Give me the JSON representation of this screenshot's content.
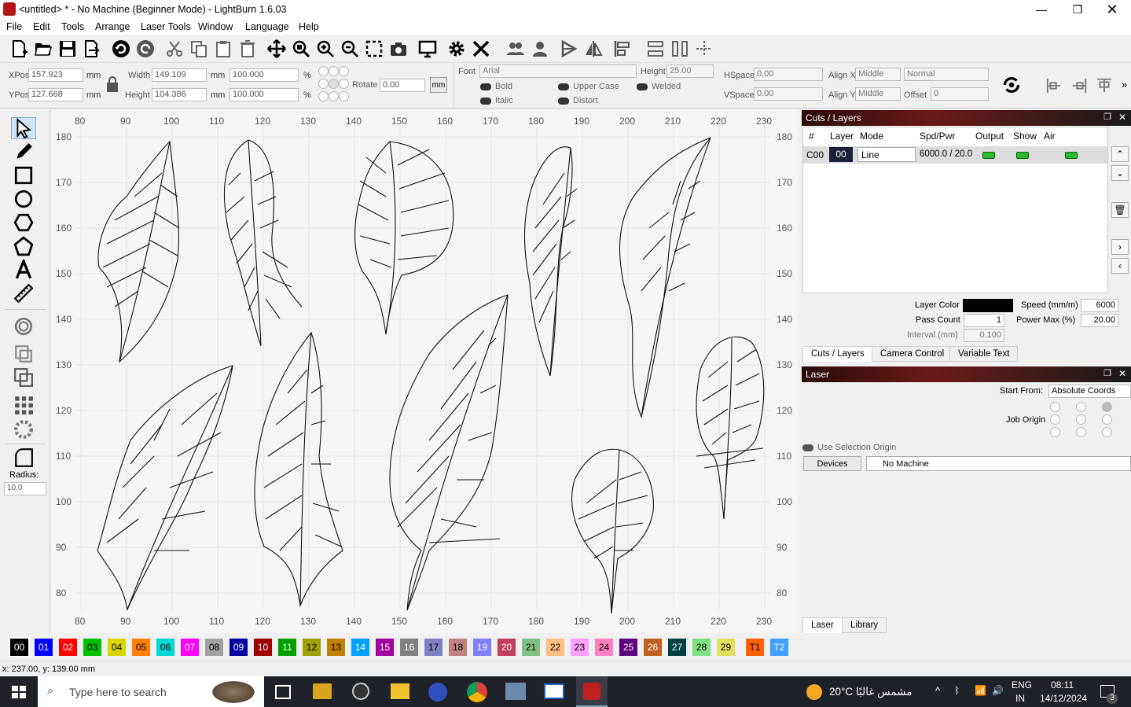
{
  "window": {
    "title": "<untitled> * - No Machine (Beginner Mode) - LightBurn 1.6.03"
  },
  "menu": [
    "File",
    "Edit",
    "Tools",
    "Arrange",
    "Laser Tools",
    "Window",
    "Language",
    "Help"
  ],
  "toolbar_icons": [
    "new-file",
    "open-file",
    "save",
    "export",
    "undo",
    "redo",
    "cut",
    "copy",
    "paste",
    "delete",
    "move",
    "zoom-frame",
    "zoom-in",
    "zoom-out",
    "select-rect",
    "camera",
    "monitor",
    "settings",
    "tools",
    "group",
    "user",
    "send",
    "mirror",
    "align"
  ],
  "props": {
    "xpos_label": "XPos",
    "xpos": "157.923",
    "ypos_label": "YPos",
    "ypos": "127.668",
    "unit_mm": "mm",
    "width_label": "Width",
    "width": "149.109",
    "height_label": "Height",
    "height": "104.386",
    "wpct": "100.000",
    "hpct": "100.000",
    "pct": "%",
    "rotate_label": "Rotate",
    "rotate": "0.00",
    "mm_btn": "mm",
    "font_label": "Font",
    "font": "Arial",
    "fheight_label": "Height",
    "fheight": "25.00",
    "bold": "Bold",
    "italic": "Italic",
    "upper": "Upper Case",
    "welded": "Welded",
    "distort": "Distort",
    "hspace_label": "HSpace",
    "hspace": "0.00",
    "vspace_label": "VSpace",
    "vspace": "0.00",
    "alignx_label": "Align X",
    "alignx": "Middle",
    "aligny_label": "Align Y",
    "aligny": "Middle",
    "normal": "Normal",
    "offset_label": "Offset",
    "offset": "0"
  },
  "left": {
    "radius_label": "Radius:",
    "radius": "10.0"
  },
  "ruler": {
    "x": [
      "80",
      "90",
      "100",
      "110",
      "120",
      "130",
      "140",
      "150",
      "160",
      "170",
      "180",
      "190",
      "200",
      "210",
      "220",
      "230"
    ],
    "y": [
      "180",
      "170",
      "160",
      "150",
      "140",
      "130",
      "120",
      "110",
      "100",
      "90",
      "80"
    ]
  },
  "palette": [
    {
      "t": "00",
      "c": "#000000",
      "f": "#ffffff"
    },
    {
      "t": "01",
      "c": "#0000ff",
      "f": "#ffffff"
    },
    {
      "t": "02",
      "c": "#ff0000",
      "f": "#ffffff"
    },
    {
      "t": "03",
      "c": "#00c000",
      "f": "#000000"
    },
    {
      "t": "04",
      "c": "#d8d800",
      "f": "#000000"
    },
    {
      "t": "05",
      "c": "#ff8000",
      "f": "#000000"
    },
    {
      "t": "06",
      "c": "#00d8d8",
      "f": "#000000"
    },
    {
      "t": "07",
      "c": "#ff00ff",
      "f": "#ffffff"
    },
    {
      "t": "08",
      "c": "#a0a0a0",
      "f": "#000000"
    },
    {
      "t": "09",
      "c": "#0000a0",
      "f": "#ffffff"
    },
    {
      "t": "10",
      "c": "#a00000",
      "f": "#ffffff"
    },
    {
      "t": "11",
      "c": "#00a000",
      "f": "#ffffff"
    },
    {
      "t": "12",
      "c": "#a0a000",
      "f": "#000000"
    },
    {
      "t": "13",
      "c": "#c08000",
      "f": "#000000"
    },
    {
      "t": "14",
      "c": "#00a0ff",
      "f": "#ffffff"
    },
    {
      "t": "15",
      "c": "#a000a0",
      "f": "#ffffff"
    },
    {
      "t": "16",
      "c": "#808080",
      "f": "#ffffff"
    },
    {
      "t": "17",
      "c": "#8080c0",
      "f": "#000000"
    },
    {
      "t": "18",
      "c": "#c08080",
      "f": "#000000"
    },
    {
      "t": "19",
      "c": "#8080ff",
      "f": "#ffffff"
    },
    {
      "t": "20",
      "c": "#c04060",
      "f": "#ffffff"
    },
    {
      "t": "21",
      "c": "#80c080",
      "f": "#000000"
    },
    {
      "t": "22",
      "c": "#ffc080",
      "f": "#000000"
    },
    {
      "t": "23",
      "c": "#ffa0ff",
      "f": "#000000"
    },
    {
      "t": "24",
      "c": "#ff80c0",
      "f": "#000000"
    },
    {
      "t": "25",
      "c": "#600080",
      "f": "#ffffff"
    },
    {
      "t": "26",
      "c": "#c06020",
      "f": "#ffffff"
    },
    {
      "t": "27",
      "c": "#004040",
      "f": "#ffffff"
    },
    {
      "t": "28",
      "c": "#80e080",
      "f": "#000000"
    },
    {
      "t": "29",
      "c": "#e0e060",
      "f": "#000000"
    },
    {
      "t": "T1",
      "c": "#ff6000",
      "f": "#000000"
    },
    {
      "t": "T2",
      "c": "#40a0ff",
      "f": "#ffffff"
    }
  ],
  "status": {
    "coords": "x: 237.00, y: 139.00 mm"
  },
  "cuts": {
    "title": "Cuts / Layers",
    "headers": [
      "#",
      "Layer",
      "Mode",
      "Spd/Pwr",
      "Output",
      "Show",
      "Air"
    ],
    "row": {
      "num": "C00",
      "layer": "00",
      "mode": "Line",
      "spdpwr": "6000.0 / 20.0"
    },
    "layer_color_label": "Layer Color",
    "pass_count_label": "Pass Count",
    "pass_count": "1",
    "interval_label": "Interval (mm)",
    "interval": "0.100",
    "speed_label": "Speed (mm/m)",
    "speed": "6000",
    "power_label": "Power Max (%)",
    "power": "20.00",
    "tabs": [
      "Cuts / Layers",
      "Camera Control",
      "Variable Text"
    ]
  },
  "laser": {
    "title": "Laser",
    "start_from_label": "Start From:",
    "start_from": "Absolute Coords",
    "job_origin_label": "Job Origin",
    "use_sel": "Use Selection Origin",
    "devices": "Devices",
    "device": "No Machine",
    "tabs": [
      "Laser",
      "Library"
    ]
  },
  "taskbar": {
    "search": "Type here to search",
    "weather": "20°C  مشمس غالبًا",
    "lang1": "ENG",
    "lang2": "IN",
    "time": "08:11",
    "date": "14/12/2024",
    "notif": "3"
  }
}
